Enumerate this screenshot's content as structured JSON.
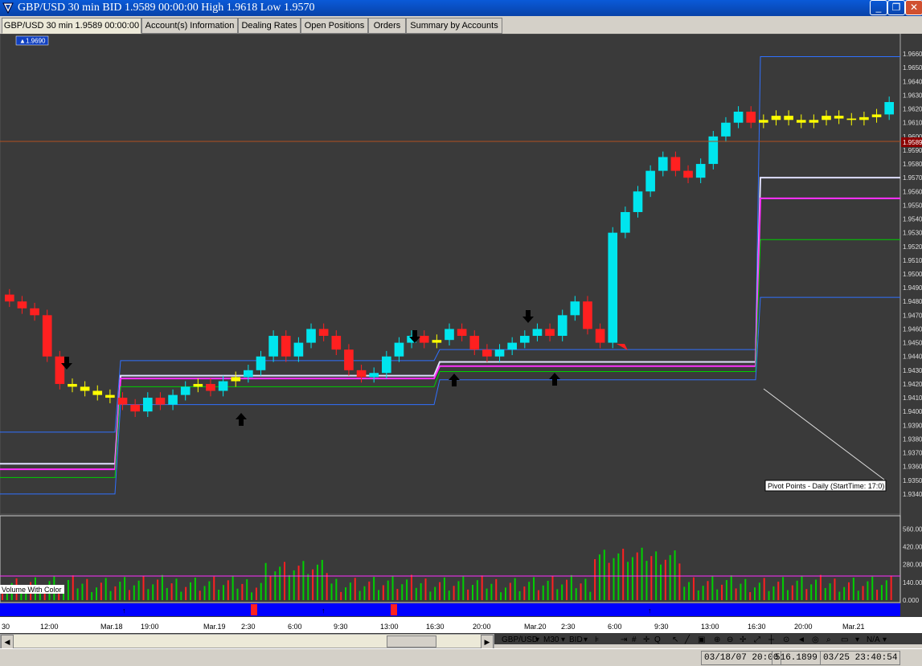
{
  "window": {
    "title": "GBP/USD 30 min BID 1.9589 00:00:00 High 1.9618 Low 1.9570",
    "minimize": "_",
    "restore": "❐",
    "close": "✕"
  },
  "tabs": [
    {
      "label": "GBP/USD 30 min 1.9589 00:00:00"
    },
    {
      "label": "Account(s) Information"
    },
    {
      "label": "Dealing Rates"
    },
    {
      "label": "Open Positions"
    },
    {
      "label": "Orders"
    },
    {
      "label": "Summary by Accounts"
    }
  ],
  "chart": {
    "marker_label": "1.9690",
    "current_price": "1.9589",
    "price_ticks": [
      "1.9660",
      "1.9650",
      "1.9640",
      "1.9630",
      "1.9620",
      "1.9610",
      "1.9600",
      "1.9590",
      "1.9580",
      "1.9570",
      "1.9560",
      "1.9550",
      "1.9540",
      "1.9530",
      "1.9520",
      "1.9510",
      "1.9500",
      "1.9490",
      "1.9480",
      "1.9470",
      "1.9460",
      "1.9450",
      "1.9440",
      "1.9430",
      "1.9420",
      "1.9410",
      "1.9400",
      "1.9390",
      "1.9380",
      "1.9370",
      "1.9360",
      "1.9350",
      "1.9340"
    ],
    "pivot_label": "Pivot Points - Daily (StartTime: 17:0)",
    "volume_label": "Volume With Color",
    "volume_ticks": [
      "560.00",
      "420.00",
      "280.00",
      "140.00",
      "0.000"
    ],
    "time_labels": [
      "30",
      "12:00",
      "Mar.18",
      "19:00",
      "Mar.19",
      "2:30",
      "6:00",
      "9:30",
      "13:00",
      "16:30",
      "20:00",
      "Mar.20",
      "2:30",
      "6:00",
      "9:30",
      "13:00",
      "16:30",
      "20:00",
      "Mar.21"
    ],
    "colors": {
      "background": "#3a3a3a",
      "bull": "#00e5ee",
      "bear": "#ff2020",
      "neutral": "#ffff00",
      "green": "#00d000",
      "magenta": "#ff30ff",
      "blue": "#3070ff"
    }
  },
  "chart_data": {
    "type": "candlestick",
    "title": "GBP/USD 30 min",
    "ylim": [
      1.933,
      1.967
    ],
    "close_series": [
      1.948,
      1.9475,
      1.947,
      1.944,
      1.942,
      1.9418,
      1.9415,
      1.9412,
      1.941,
      1.9405,
      1.94,
      1.941,
      1.9405,
      1.9412,
      1.9418,
      1.942,
      1.9415,
      1.9422,
      1.9425,
      1.943,
      1.944,
      1.9455,
      1.944,
      1.945,
      1.946,
      1.9455,
      1.9445,
      1.943,
      1.9425,
      1.9428,
      1.944,
      1.945,
      1.9455,
      1.945,
      1.9452,
      1.946,
      1.9455,
      1.9445,
      1.944,
      1.9445,
      1.945,
      1.9455,
      1.946,
      1.9455,
      1.947,
      1.948,
      1.946,
      1.945,
      1.953,
      1.9545,
      1.956,
      1.9575,
      1.9585,
      1.9575,
      1.957,
      1.958,
      1.96,
      1.961,
      1.9618,
      1.961,
      1.9612,
      1.9615,
      1.9612,
      1.961,
      1.9612,
      1.9615,
      1.9613,
      1.9612,
      1.9614,
      1.9616,
      1.9625
    ],
    "pivot_levels": {
      "R2": 1.9658,
      "R1": 1.957,
      "PP": 1.9555,
      "S1": 1.9525,
      "S2": 1.9483
    },
    "volume_ylim": [
      0,
      600
    ]
  },
  "toolbar": {
    "symbol": "GBP/USD",
    "period": "M30",
    "price": "BID",
    "zoom": "N/A"
  },
  "status": {
    "date": "03/18/07 20:00",
    "value": "516.1899",
    "time": "03/25 23:40:54"
  }
}
